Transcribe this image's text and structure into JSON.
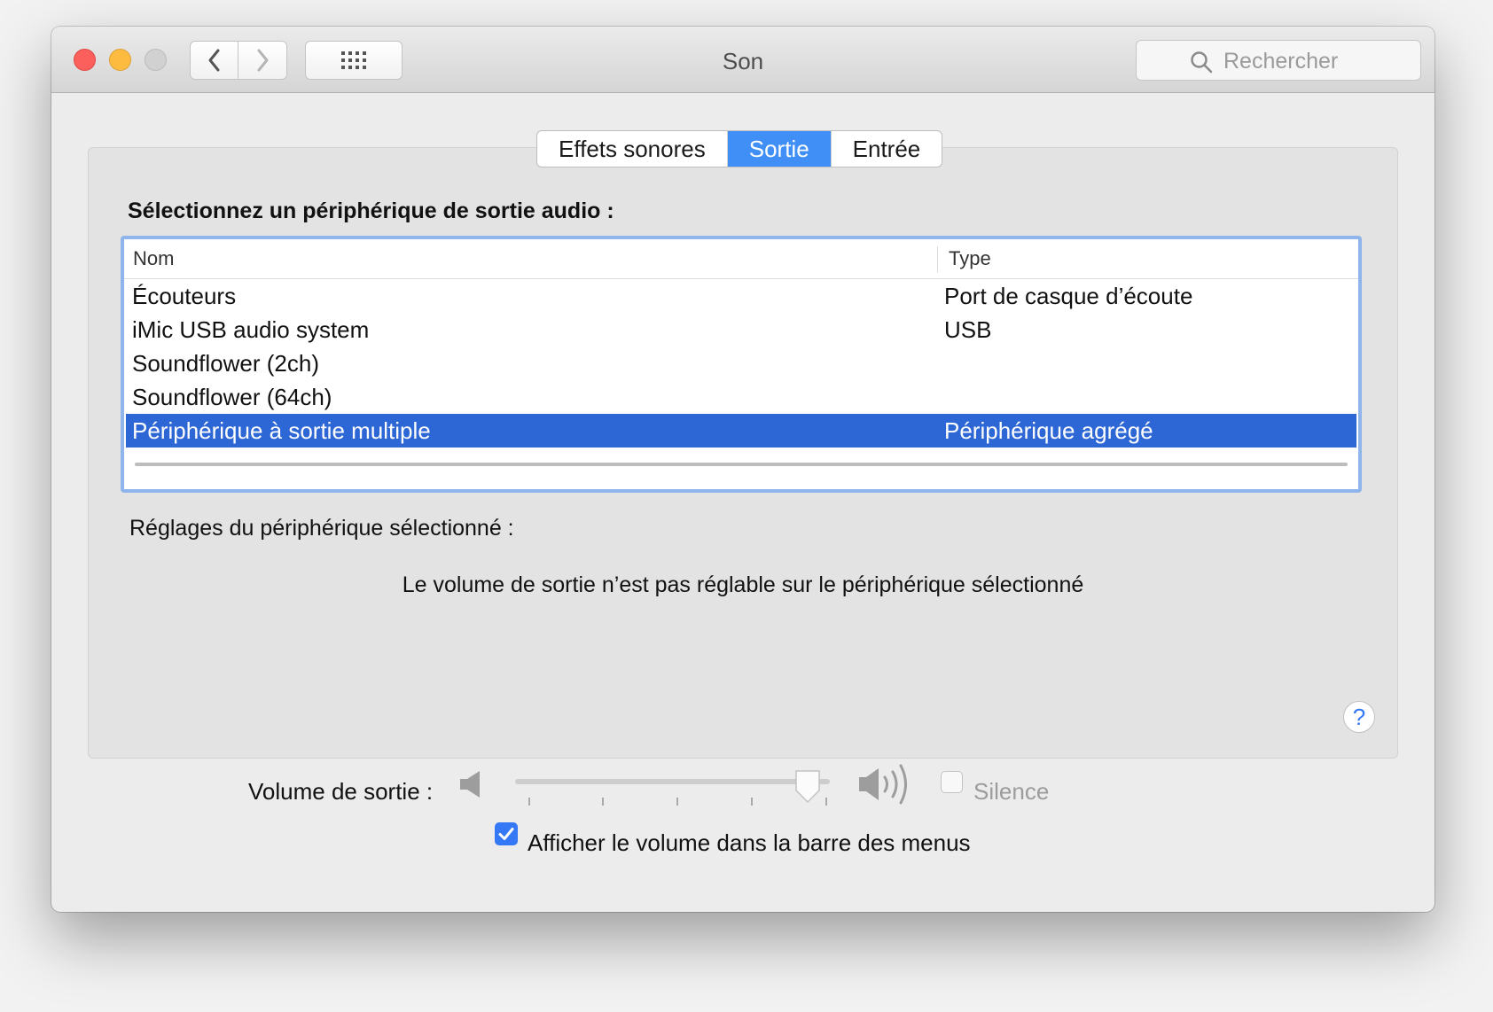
{
  "window": {
    "title": "Son"
  },
  "search": {
    "placeholder": "Rechercher"
  },
  "tabs": [
    {
      "label": "Effets sonores",
      "active": false
    },
    {
      "label": "Sortie",
      "active": true
    },
    {
      "label": "Entrée",
      "active": false
    }
  ],
  "section_title": "Sélectionnez un périphérique de sortie audio :",
  "table": {
    "headers": {
      "name": "Nom",
      "type": "Type"
    },
    "rows": [
      {
        "name": "Écouteurs",
        "type": "Port de casque d’écoute"
      },
      {
        "name": "iMic USB audio system",
        "type": "USB"
      },
      {
        "name": "Soundflower (2ch)",
        "type": ""
      },
      {
        "name": "Soundflower (64ch)",
        "type": ""
      },
      {
        "name": "Périphérique à sortie multiple",
        "type": "Périphérique agrégé",
        "selected": true
      }
    ]
  },
  "settings": {
    "label": "Réglages du périphérique sélectionné :",
    "note": "Le volume de sortie n’est pas réglable sur le périphérique sélectionné"
  },
  "help": {
    "label": "?"
  },
  "volume": {
    "label": "Volume de sortie :",
    "level": 0.93,
    "silence_label": "Silence",
    "silence_checked": false
  },
  "menubar_option": {
    "label": "Afficher le volume dans la barre des menus",
    "checked": true
  },
  "icons": {
    "back": "chevron-left-icon",
    "forward": "chevron-right-icon",
    "grid": "grid-icon",
    "search": "search-icon",
    "speaker_low": "speaker-low-icon",
    "speaker_high": "speaker-high-icon",
    "checkmark": "checkmark-icon"
  },
  "colors": {
    "accent": "#3f8ff7",
    "selection": "#2d67d5",
    "close": "#fc605c",
    "minimize": "#fdbc40",
    "zoom": "#d1d1d1",
    "focus_ring": "#8fb5ec"
  }
}
